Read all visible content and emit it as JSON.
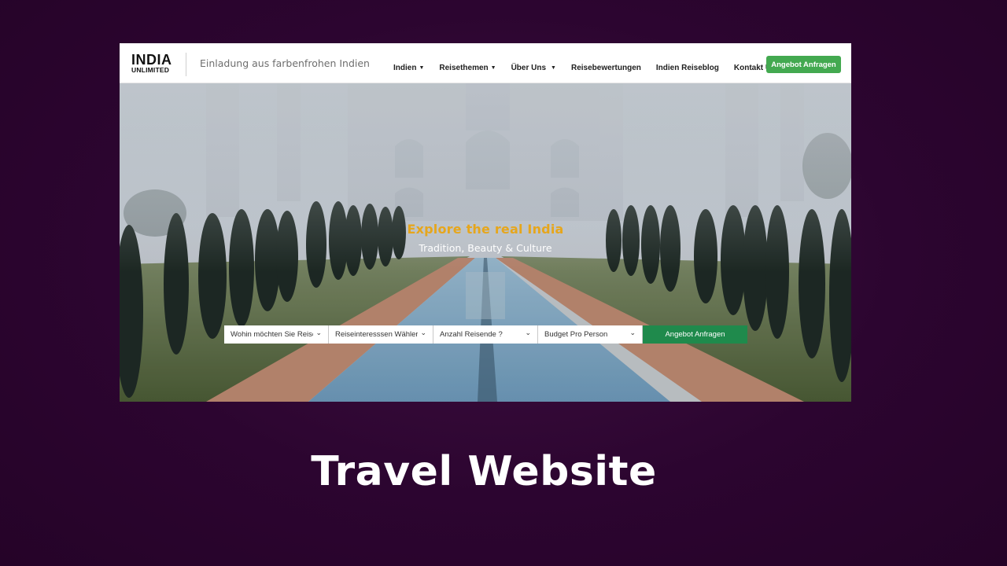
{
  "navbar": {
    "logo": {
      "line1": "INDIA",
      "line2": "UNLIMITED"
    },
    "tagline": "Einladung aus farbenfrohen Indien",
    "menu": [
      {
        "label": "Indien",
        "dropdown": true
      },
      {
        "label": "Reisethemen",
        "dropdown": true
      },
      {
        "label": "Über Uns",
        "dropdown": true
      },
      {
        "label": "Reisebewertungen",
        "dropdown": false
      },
      {
        "label": "Indien Reiseblog",
        "dropdown": false
      },
      {
        "label": "Kontakt Uns",
        "dropdown": false
      }
    ],
    "cta_label": "Angebot Anfragen"
  },
  "hero": {
    "title": "Explore the real India",
    "subtitle": "Tradition, Beauty & Culture"
  },
  "search": {
    "fields": [
      {
        "label": "Wohin möchten Sie Reisen"
      },
      {
        "label": "Reiseinteresssen Wähler"
      },
      {
        "label": "Anzahl Reisende ?"
      },
      {
        "label": "Budget Pro Person"
      }
    ],
    "submit_label": "Angebot Anfragen"
  },
  "caption": "Travel Website",
  "colors": {
    "background": "#2c0530",
    "nav_cta": "#43a950",
    "search_button": "#1f8a4c",
    "hero_title": "#e6a61c"
  },
  "icons": {
    "dropdown": "caret-down-icon",
    "select": "chevron-down-icon"
  }
}
